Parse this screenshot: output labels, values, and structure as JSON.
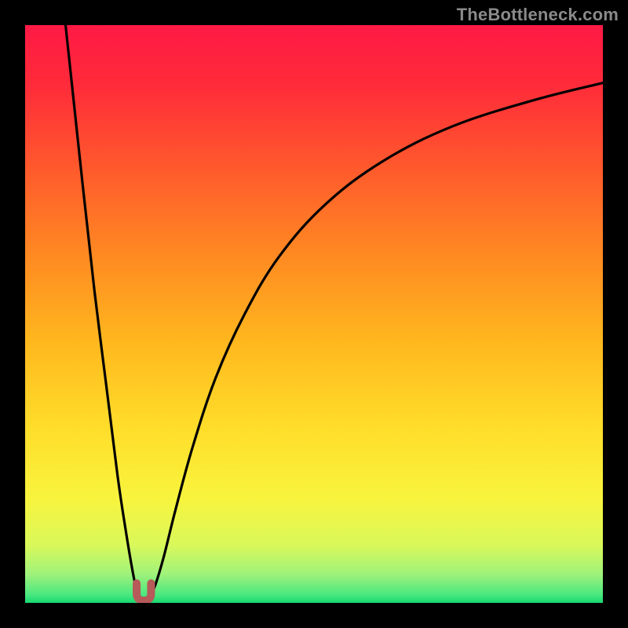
{
  "watermark": "TheBottleneck.com",
  "colors": {
    "black": "#000000",
    "curve": "#000000",
    "marker": "#b75a5a",
    "watermark": "#8a8a8a",
    "gradient_stops": [
      {
        "offset": 0.0,
        "color": "#ff1a45"
      },
      {
        "offset": 0.1,
        "color": "#ff2a3a"
      },
      {
        "offset": 0.25,
        "color": "#ff5a2c"
      },
      {
        "offset": 0.4,
        "color": "#ff8a22"
      },
      {
        "offset": 0.55,
        "color": "#ffb81e"
      },
      {
        "offset": 0.7,
        "color": "#ffde2a"
      },
      {
        "offset": 0.82,
        "color": "#f8f43e"
      },
      {
        "offset": 0.9,
        "color": "#d9f85a"
      },
      {
        "offset": 0.95,
        "color": "#a0f27a"
      },
      {
        "offset": 0.985,
        "color": "#4de880"
      },
      {
        "offset": 1.0,
        "color": "#18d870"
      }
    ]
  },
  "chart_data": {
    "type": "line",
    "title": "",
    "xlabel": "",
    "ylabel": "",
    "xlim": [
      0,
      100
    ],
    "ylim": [
      0,
      100
    ],
    "grid": false,
    "legend": false,
    "notes": "Bottleneck-style curve: two branches descending to a minimum near x≈20, y≈0; left branch starts near (7,100), right branch rises asymptotically toward y≈90 at x=100. A small U-shaped marker sits at the minimum.",
    "series": [
      {
        "name": "left-branch",
        "x": [
          7.0,
          8.5,
          10.0,
          12.0,
          14.0,
          16.0,
          17.5,
          18.6,
          19.3,
          19.8
        ],
        "y": [
          100,
          86,
          72,
          54,
          38,
          22,
          12,
          5.5,
          2.2,
          0.8
        ]
      },
      {
        "name": "right-branch",
        "x": [
          21.5,
          22.5,
          24.0,
          26.0,
          29.0,
          33.0,
          38.0,
          44.0,
          52.0,
          62.0,
          74.0,
          88.0,
          100.0
        ],
        "y": [
          0.8,
          3.0,
          8.0,
          16.0,
          27.0,
          39.0,
          50.0,
          60.0,
          69.0,
          76.5,
          82.5,
          87.0,
          90.0
        ]
      }
    ],
    "marker": {
      "name": "minimum-marker",
      "shape": "u",
      "x_range": [
        19.3,
        21.8
      ],
      "y": 0.4,
      "height": 3.0,
      "color": "#b75a5a"
    }
  }
}
